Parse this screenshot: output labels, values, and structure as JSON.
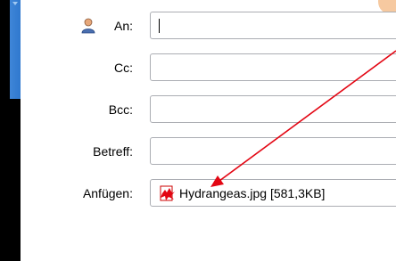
{
  "form": {
    "to_label": "An:",
    "cc_label": "Cc:",
    "bcc_label": "Bcc:",
    "subject_label": "Betreff:",
    "attach_label": "Anfügen:",
    "to_value": "",
    "cc_value": "",
    "bcc_value": "",
    "subject_value": "",
    "attachment": "Hydrangeas.jpg [581,3KB]"
  },
  "icons": {
    "to": "user-icon",
    "attachment_file": "image-file-icon",
    "annotation": "red-arrow"
  },
  "colors": {
    "annotation_arrow": "#e30613",
    "sidebar_accent": "#2f78ce",
    "field_border": "#abadb3"
  }
}
